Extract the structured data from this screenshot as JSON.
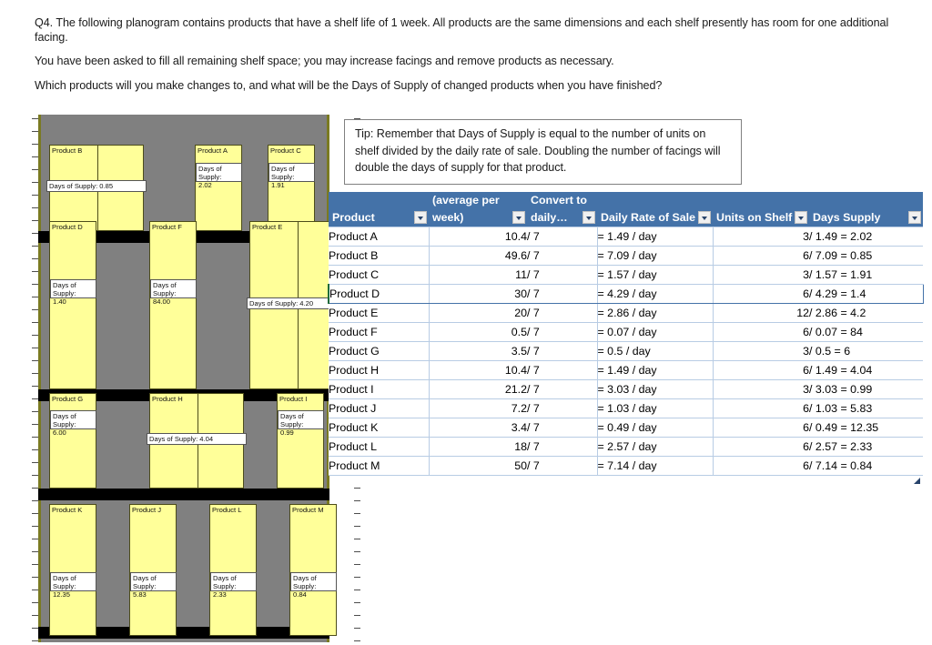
{
  "question": {
    "paragraphs": [
      "Q4. The following planogram contains products that have a shelf life of 1 week.  All products are the same dimensions and each shelf presently has room for one additional facing.",
      "You have been asked to fill all remaining shelf space; you may increase facings and remove products as necessary.",
      "Which products will you make changes to, and what will be the Days of Supply of changed products when you have finished?"
    ]
  },
  "tip": {
    "text": "Tip: Remember that Days of Supply is equal to the number of units on shelf divided by the daily rate of sale.  Doubling the number of facings will double the days of supply for that product."
  },
  "planogram": {
    "shelves": [
      {
        "name": "shelf-1",
        "products": [
          {
            "label": "Product B",
            "dos": "Days of Supply: 0.85",
            "facings": 2,
            "rows": 1,
            "dos_style": "wide"
          },
          {
            "label": "Product A",
            "dos": "Days of Supply:\n2.02",
            "facings": 1,
            "rows": 1,
            "dos_style": "narrow"
          },
          {
            "label": "Product C",
            "dos": "Days of Supply:\n1.91",
            "facings": 1,
            "rows": 1,
            "dos_style": "narrow"
          }
        ]
      },
      {
        "name": "shelf-2",
        "products": [
          {
            "label": "Product D",
            "dos": "Days of Supply:\n1.40",
            "facings": 1,
            "rows": 1,
            "dos_style": "narrow"
          },
          {
            "label": "Product F",
            "dos": "Days of Supply:\n84.00",
            "facings": 1,
            "rows": 1,
            "dos_style": "narrow"
          },
          {
            "label": "Product E",
            "dos": "Days of Supply:  4.20",
            "facings": 2,
            "rows": 2,
            "dos_style": "wide"
          }
        ]
      },
      {
        "name": "shelf-3",
        "products": [
          {
            "label": "Product G",
            "dos": "Days of Supply:\n6.00",
            "facings": 1,
            "rows": 1,
            "dos_style": "narrow"
          },
          {
            "label": "Product H",
            "dos": "Days of Supply: 4.04",
            "facings": 2,
            "rows": 1,
            "dos_style": "wide"
          },
          {
            "label": "Product I",
            "dos": "Days of Supply:\n0.99",
            "facings": 1,
            "rows": 1,
            "dos_style": "narrow"
          }
        ]
      },
      {
        "name": "shelf-4",
        "products": [
          {
            "label": "Product K",
            "dos": "Days of Supply:\n12.35",
            "facings": 1,
            "rows": 1,
            "dos_style": "narrow"
          },
          {
            "label": "Product J",
            "dos": "Days of Supply:\n5.83",
            "facings": 1,
            "rows": 1,
            "dos_style": "narrow"
          },
          {
            "label": "Product L",
            "dos": "Days of Supply:\n2.33",
            "facings": 1,
            "rows": 1,
            "dos_style": "narrow"
          },
          {
            "label": "Product M",
            "dos": "Days of Supply:\n0.84",
            "facings": 1,
            "rows": 1,
            "dos_style": "narrow"
          }
        ]
      }
    ]
  },
  "table": {
    "accent_color": "#4472a8",
    "grid_color": "#b8cce4",
    "header_top": [
      "",
      "(average per",
      "Convert to",
      "",
      "",
      ""
    ],
    "header_bottom": [
      "Product",
      "week)",
      "daily…",
      "Daily Rate of Sale",
      "Units on Shelf",
      "Days Supply"
    ],
    "selected_row_index": 3,
    "rows": [
      {
        "product": "Product A",
        "week": "10.4",
        "div7": "/ 7",
        "rate": "= 1.49 / day",
        "units": "3",
        "days": "/ 1.49 = 2.02"
      },
      {
        "product": "Product B",
        "week": "49.6",
        "div7": "/ 7",
        "rate": "= 7.09 / day",
        "units": "6",
        "days": "/ 7.09 = 0.85"
      },
      {
        "product": "Product C",
        "week": "11",
        "div7": "/ 7",
        "rate": "= 1.57 / day",
        "units": "3",
        "days": "/ 1.57 = 1.91"
      },
      {
        "product": "Product D",
        "week": "30",
        "div7": "/ 7",
        "rate": "= 4.29 / day",
        "units": "6",
        "days": "/ 4.29 = 1.4"
      },
      {
        "product": "Product E",
        "week": "20",
        "div7": "/ 7",
        "rate": "= 2.86 / day",
        "units": "12",
        "days": "/ 2.86 = 4.2"
      },
      {
        "product": "Product F",
        "week": "0.5",
        "div7": "/ 7",
        "rate": "= 0.07 / day",
        "units": "6",
        "days": "/ 0.07 = 84"
      },
      {
        "product": "Product G",
        "week": "3.5",
        "div7": "/ 7",
        "rate": "= 0.5 / day",
        "units": "3",
        "days": "/ 0.5 = 6"
      },
      {
        "product": "Product H",
        "week": "10.4",
        "div7": "/ 7",
        "rate": "= 1.49 / day",
        "units": "6",
        "days": "/ 1.49 = 4.04"
      },
      {
        "product": "Product I",
        "week": "21.2",
        "div7": "/ 7",
        "rate": "= 3.03 / day",
        "units": "3",
        "days": "/ 3.03 = 0.99"
      },
      {
        "product": "Product J",
        "week": "7.2",
        "div7": "/ 7",
        "rate": "= 1.03 / day",
        "units": "6",
        "days": "/ 1.03 = 5.83"
      },
      {
        "product": "Product K",
        "week": "3.4",
        "div7": "/ 7",
        "rate": "= 0.49 / day",
        "units": "6",
        "days": "/ 0.49 = 12.35"
      },
      {
        "product": "Product L",
        "week": "18",
        "div7": "/ 7",
        "rate": "= 2.57 / day",
        "units": "6",
        "days": "/ 2.57 = 2.33"
      },
      {
        "product": "Product M",
        "week": "50",
        "div7": "/ 7",
        "rate": "= 7.14 / day",
        "units": "6",
        "days": "/ 7.14 = 0.84"
      }
    ]
  }
}
